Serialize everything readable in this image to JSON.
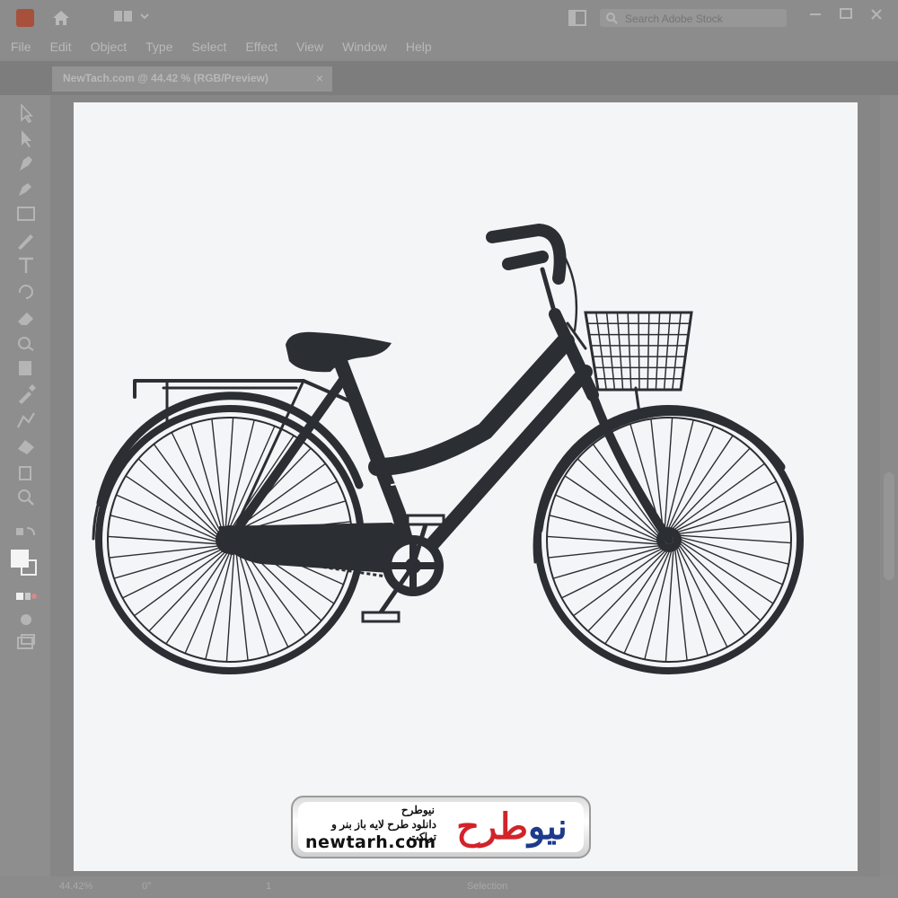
{
  "menu": [
    "File",
    "Edit",
    "Object",
    "Type",
    "Select",
    "Effect",
    "View",
    "Window",
    "Help"
  ],
  "search": {
    "placeholder": "Search Adobe Stock"
  },
  "tab": {
    "title": "NewTach.com @ 44.42 % (RGB/Preview)",
    "close": "×"
  },
  "status": {
    "zoom": "44.42%",
    "angle": "0°",
    "artboard": "1",
    "mode": "Selection"
  },
  "watermark": {
    "title": "نیوطرح",
    "subtitle": "دانلود طرح لایه باز بنر و تراکت",
    "url": "newtarh.com",
    "logo_part1": "نیو",
    "logo_part2": "طرح"
  },
  "colors": {
    "bike": "#2b2e33",
    "artboard": "#f4f5f7",
    "ui": "#8c8c8c"
  }
}
